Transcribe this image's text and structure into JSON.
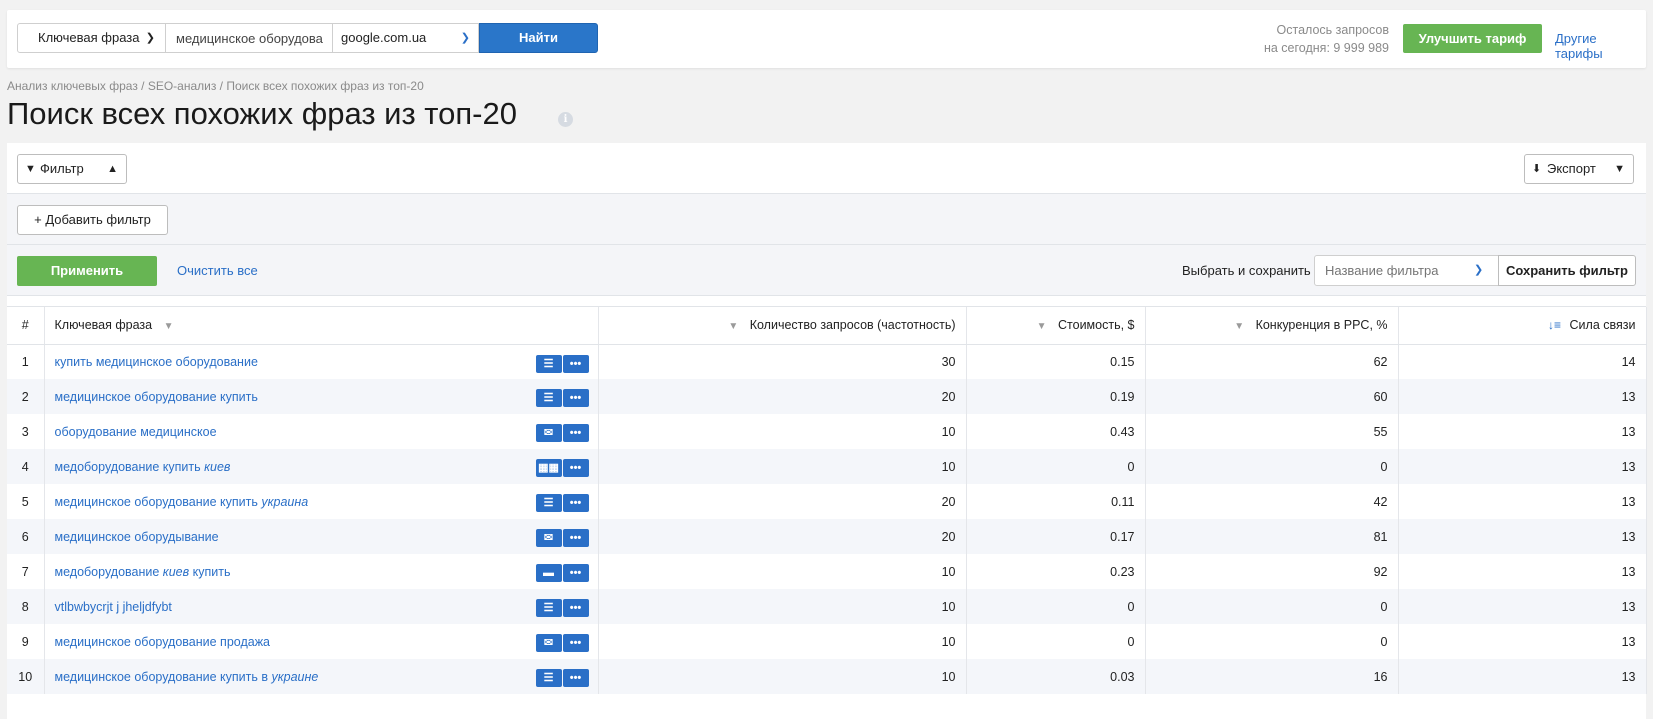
{
  "search": {
    "type_label": "Ключевая фраза",
    "query_value": "медицинское оборудова",
    "engine_label": "google.com.ua",
    "find_label": "Найти"
  },
  "quota": {
    "line1": "Осталось запросов",
    "line2": "на сегодня: 9 999 989"
  },
  "header": {
    "upgrade_label": "Улучшить тариф",
    "tariffs_label": "Другие тарифы"
  },
  "breadcrumb": "Анализ ключевых фраз / SEO-анализ / Поиск всех похожих фраз из топ-20",
  "page_title": "Поиск всех похожих фраз из топ-20",
  "filters": {
    "filter_label": "Фильтр",
    "export_label": "Экспорт",
    "add_filter_label": "+ Добавить фильтр",
    "apply_label": "Применить",
    "clear_label": "Очистить все",
    "save_label": "Выбрать и сохранить",
    "name_placeholder": "Название фильтра",
    "save_button_label": "Сохранить фильтр"
  },
  "table": {
    "columns": [
      "#",
      "Ключевая фраза",
      "Количество запросов (частотность)",
      "Стоимость, $",
      "Конкуренция в PPC, %",
      "Сила связи"
    ],
    "rows": [
      {
        "n": "1",
        "kw": "купить медицинское оборудование",
        "kw_em": "",
        "kw_tail": "",
        "icon": "list-icon",
        "volume": "30",
        "cost": "0.15",
        "ppc": "62",
        "strength": "14"
      },
      {
        "n": "2",
        "kw": "медицинское оборудование купить",
        "kw_em": "",
        "kw_tail": "",
        "icon": "list-icon",
        "volume": "20",
        "cost": "0.19",
        "ppc": "60",
        "strength": "13"
      },
      {
        "n": "3",
        "kw": "оборудование медицинское",
        "kw_em": "",
        "kw_tail": "",
        "icon": "chat-icon",
        "volume": "10",
        "cost": "0.43",
        "ppc": "55",
        "strength": "13"
      },
      {
        "n": "4",
        "kw": "медоборудование купить ",
        "kw_em": "киев",
        "kw_tail": "",
        "icon": "compare-icon",
        "volume": "10",
        "cost": "0",
        "ppc": "0",
        "strength": "13"
      },
      {
        "n": "5",
        "kw": "медицинское оборудование купить ",
        "kw_em": "украина",
        "kw_tail": "",
        "icon": "list-icon",
        "volume": "20",
        "cost": "0.11",
        "ppc": "42",
        "strength": "13"
      },
      {
        "n": "6",
        "kw": "медицинское оборудывание",
        "kw_em": "",
        "kw_tail": "",
        "icon": "chat-icon",
        "volume": "20",
        "cost": "0.17",
        "ppc": "81",
        "strength": "13"
      },
      {
        "n": "7",
        "kw": "медоборудование ",
        "kw_em": "киев",
        "kw_tail": " купить",
        "icon": "text-icon",
        "volume": "10",
        "cost": "0.23",
        "ppc": "92",
        "strength": "13"
      },
      {
        "n": "8",
        "kw": "vtlbwbycrjt j jheljdfybt",
        "kw_em": "",
        "kw_tail": "",
        "icon": "list-icon",
        "volume": "10",
        "cost": "0",
        "ppc": "0",
        "strength": "13"
      },
      {
        "n": "9",
        "kw": "медицинское оборудование продажа",
        "kw_em": "",
        "kw_tail": "",
        "icon": "chat-icon",
        "volume": "10",
        "cost": "0",
        "ppc": "0",
        "strength": "13"
      },
      {
        "n": "10",
        "kw": "медицинское оборудование купить в ",
        "kw_em": "украине",
        "kw_tail": "",
        "icon": "list-icon",
        "volume": "10",
        "cost": "0.03",
        "ppc": "16",
        "strength": "13"
      }
    ]
  },
  "colors": {
    "accent_blue": "#2a6fc7",
    "button_green": "#67b553",
    "find_blue": "#2a76c9"
  }
}
